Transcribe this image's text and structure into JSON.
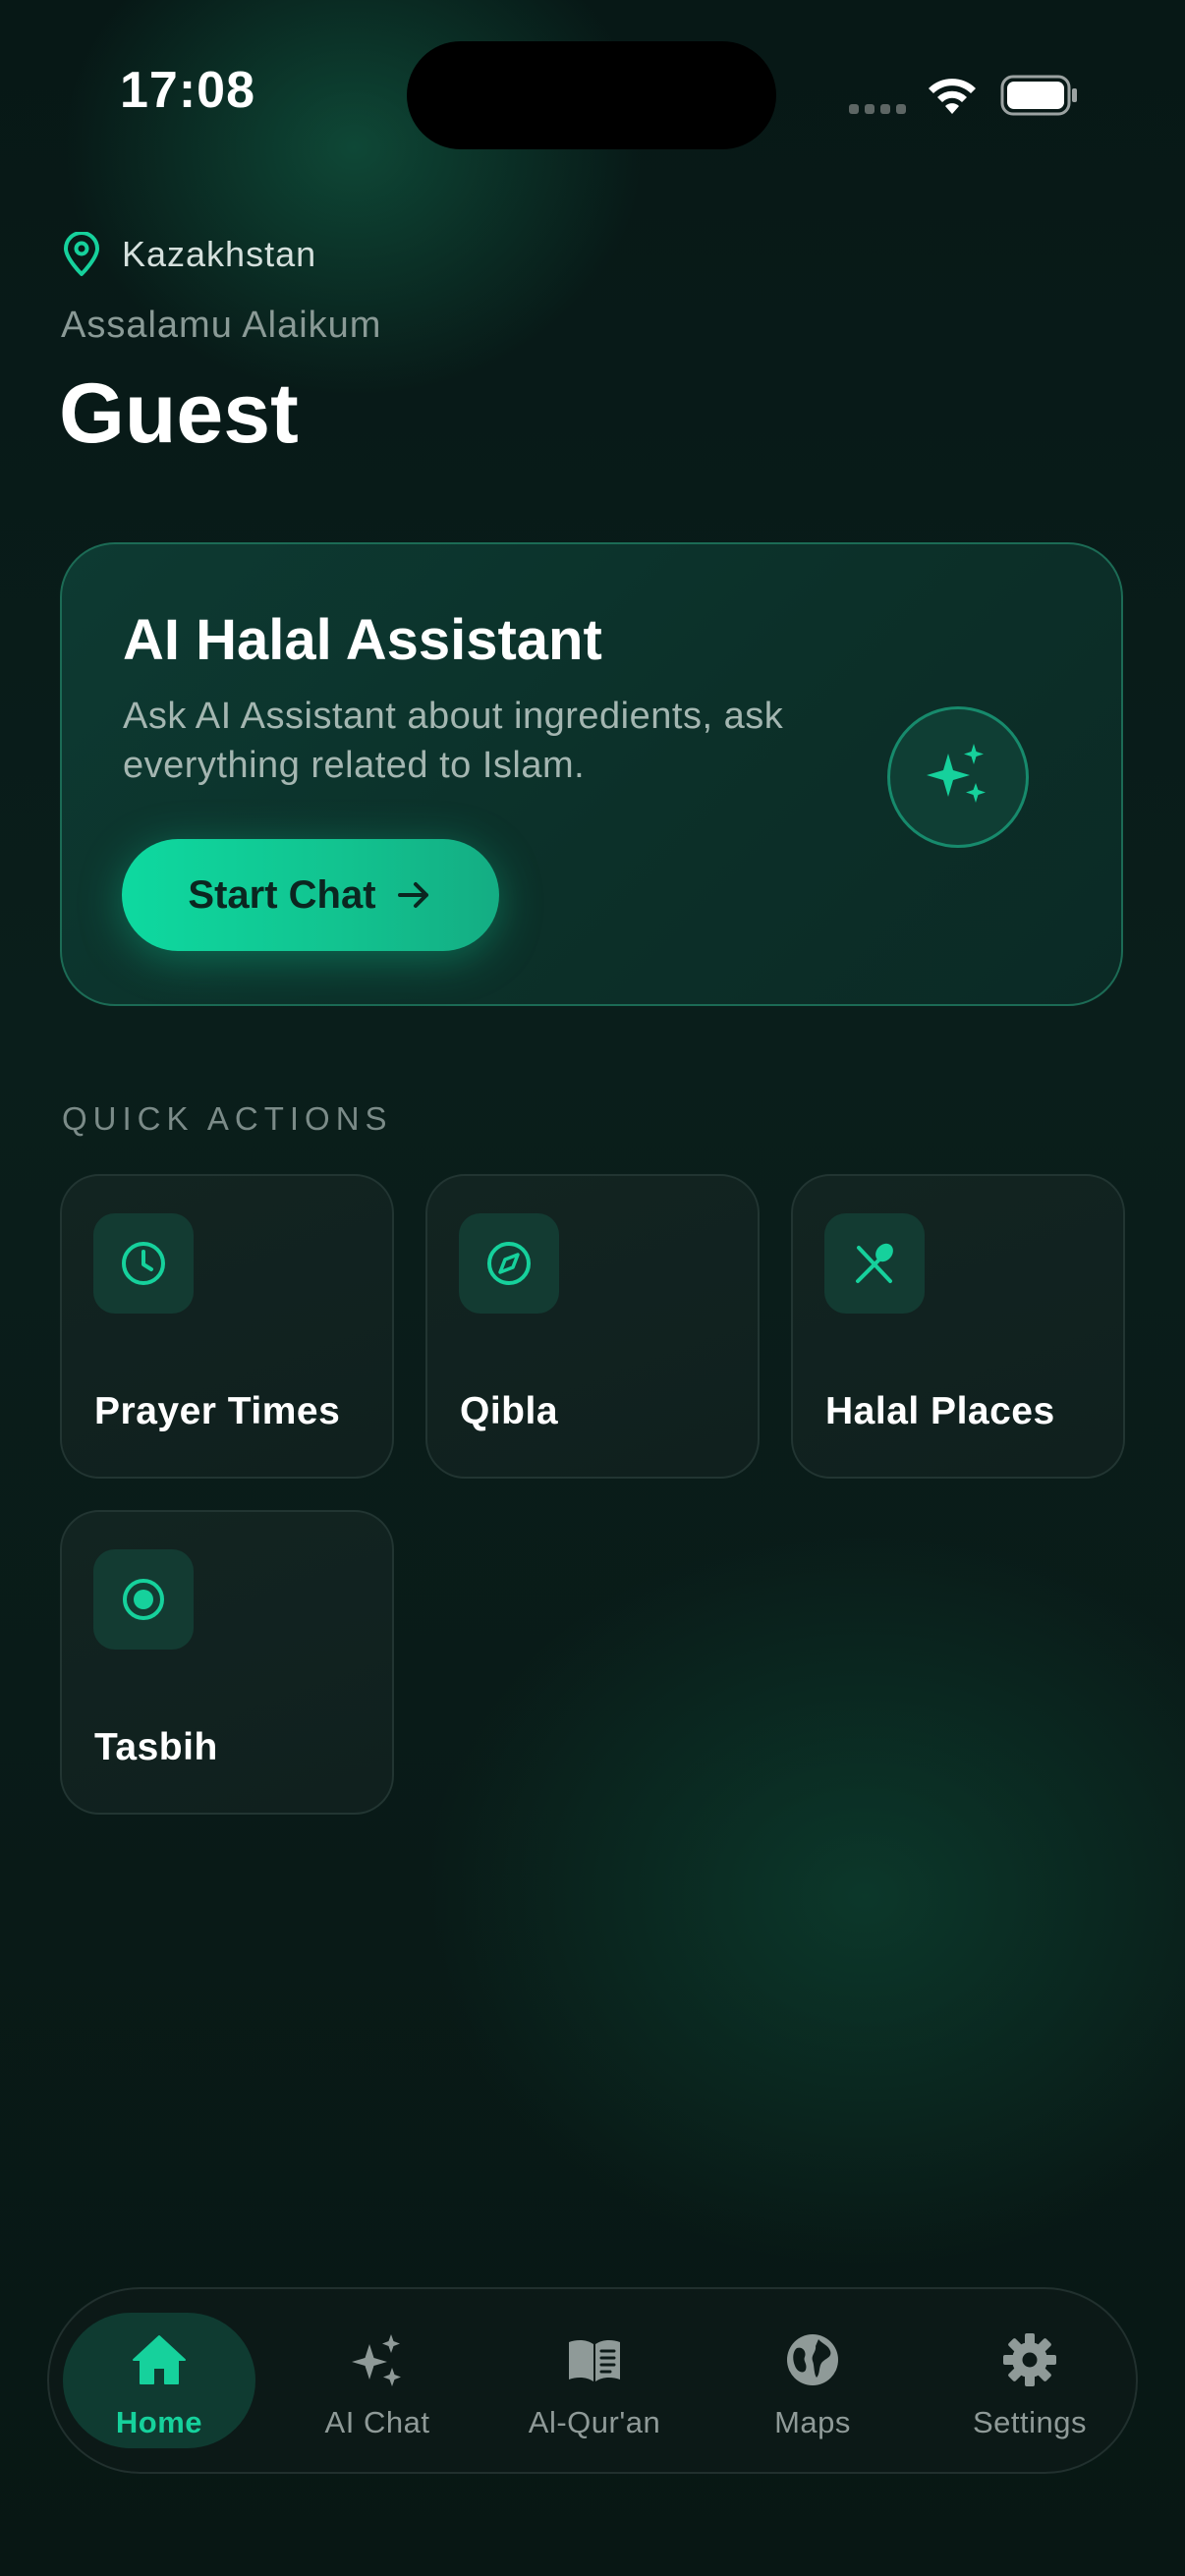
{
  "status_bar": {
    "time": "17:08"
  },
  "header": {
    "location": "Kazakhstan",
    "greeting": "Assalamu Alaikum",
    "user_name": "Guest"
  },
  "ai_card": {
    "title": "AI Halal Assistant",
    "description": "Ask AI Assistant about ingredients, ask everything related to Islam.",
    "button_label": "Start Chat",
    "button_icon": "arrow-right-icon",
    "badge_icon": "sparkles-icon"
  },
  "quick_actions": {
    "title": "QUICK ACTIONS",
    "items": [
      {
        "label": "Prayer Times",
        "icon": "clock-icon"
      },
      {
        "label": "Qibla",
        "icon": "compass-icon"
      },
      {
        "label": "Halal Places",
        "icon": "utensils-icon"
      },
      {
        "label": "Tasbih",
        "icon": "tasbih-icon"
      }
    ]
  },
  "bottom_nav": {
    "active": "Home",
    "items": [
      {
        "label": "Home",
        "icon": "home-icon"
      },
      {
        "label": "AI Chat",
        "icon": "sparkles-icon"
      },
      {
        "label": "Al-Qur'an",
        "icon": "book-icon"
      },
      {
        "label": "Maps",
        "icon": "globe-icon"
      },
      {
        "label": "Settings",
        "icon": "gear-icon"
      }
    ]
  },
  "colors": {
    "accent": "#16D19C",
    "background": "#0A1E1B",
    "card_border": "#1C6B55",
    "muted_text": "#8A9A96"
  }
}
